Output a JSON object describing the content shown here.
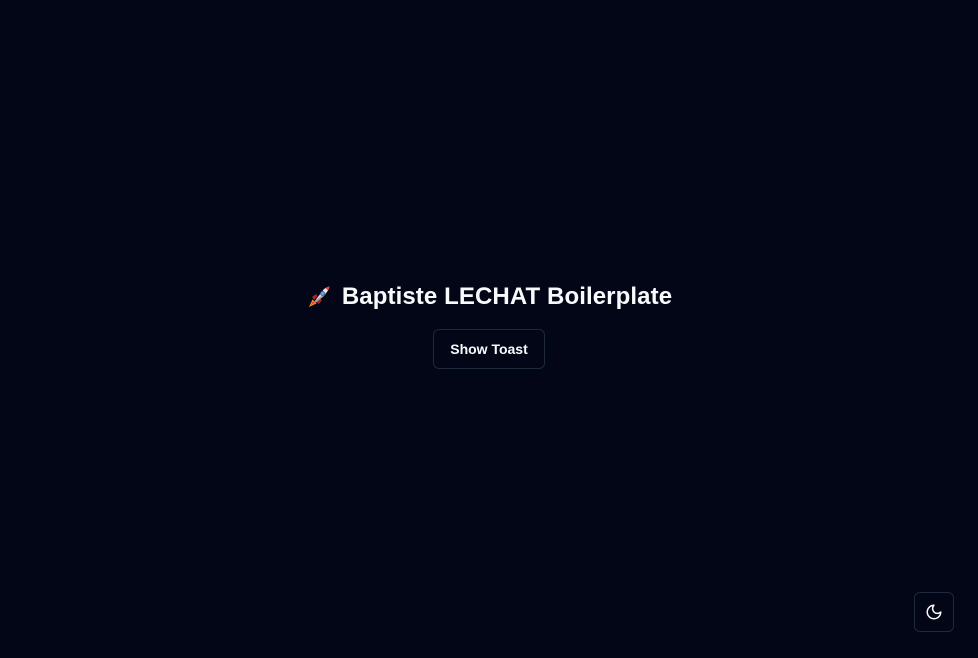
{
  "header": {
    "icon": "rocket-icon",
    "title": "Baptiste LECHAT Boilerplate"
  },
  "actions": {
    "show_toast_label": "Show Toast"
  },
  "theme_toggle": {
    "icon": "moon-icon"
  },
  "colors": {
    "background": "#020617",
    "text": "#f8fafc",
    "border": "#1e293b"
  }
}
